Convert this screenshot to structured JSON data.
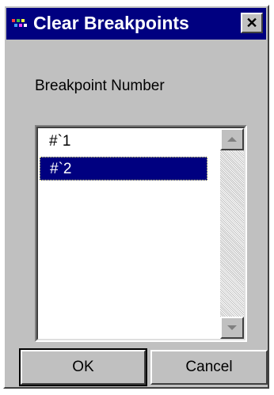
{
  "window": {
    "title": "Clear Breakpoints",
    "close_label": "✕",
    "accent_color": "#000080"
  },
  "form": {
    "label": "Breakpoint Number"
  },
  "breakpoints": {
    "items": [
      {
        "label": "#`1",
        "selected": false
      },
      {
        "label": "#`2",
        "selected": true
      }
    ]
  },
  "icons": {
    "app": "app-icon",
    "close": "close-icon",
    "scroll_up": "scroll-up-icon",
    "scroll_down": "scroll-down-icon"
  },
  "buttons": {
    "ok_label": "OK",
    "cancel_label": "Cancel"
  }
}
